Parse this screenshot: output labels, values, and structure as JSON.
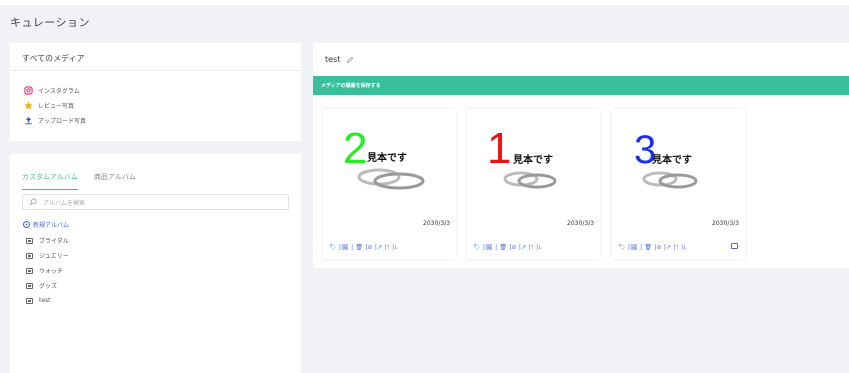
{
  "page": {
    "title": "キュレーション"
  },
  "media": {
    "header": "すべてのメディア",
    "items": [
      {
        "label": "インスタグラム",
        "icon": "instagram-icon",
        "color": "#e1306c"
      },
      {
        "label": "レビュー写真",
        "icon": "star-icon",
        "color": "#f5b400"
      },
      {
        "label": "アップロード写真",
        "icon": "upload-icon",
        "color": "#3b5fd6"
      }
    ]
  },
  "albums": {
    "tabs": [
      "カスタムアルバム",
      "商品アルバム"
    ],
    "search_placeholder": "アルバムを検索",
    "new_album_label": "新規アルバム",
    "items": [
      "ブライダル",
      "ジュエリー",
      "ウォッチ",
      "グッズ",
      "test"
    ]
  },
  "main": {
    "title": "test",
    "save_bar_label": "メディアの順番を保存する"
  },
  "cards": [
    {
      "number": "2",
      "number_color": "#22ee22",
      "caption": "見本です",
      "date": "2030/3/3",
      "actions": "🏷 |🖼 | 🗑 |⊘ |↗ |🡑 |🡓",
      "has_comment": false
    },
    {
      "number": "1",
      "number_color": "#ee1111",
      "caption": "見本です",
      "date": "2030/3/3",
      "actions": "🏷 |🖼 | 🗑 |⊘ |↗ |🡑 |🡓",
      "has_comment": false
    },
    {
      "number": "3",
      "number_color": "#1a2ff0",
      "caption": "見本です",
      "date": "2030/3/3",
      "actions": "🏷 |🖼 | 🗑 |⊘ |↗ |🡑 |🡓",
      "has_comment": true
    }
  ],
  "colors": {
    "accent": "#39bf9c",
    "link": "#4a5fd1",
    "background": "#f1f2f5"
  }
}
